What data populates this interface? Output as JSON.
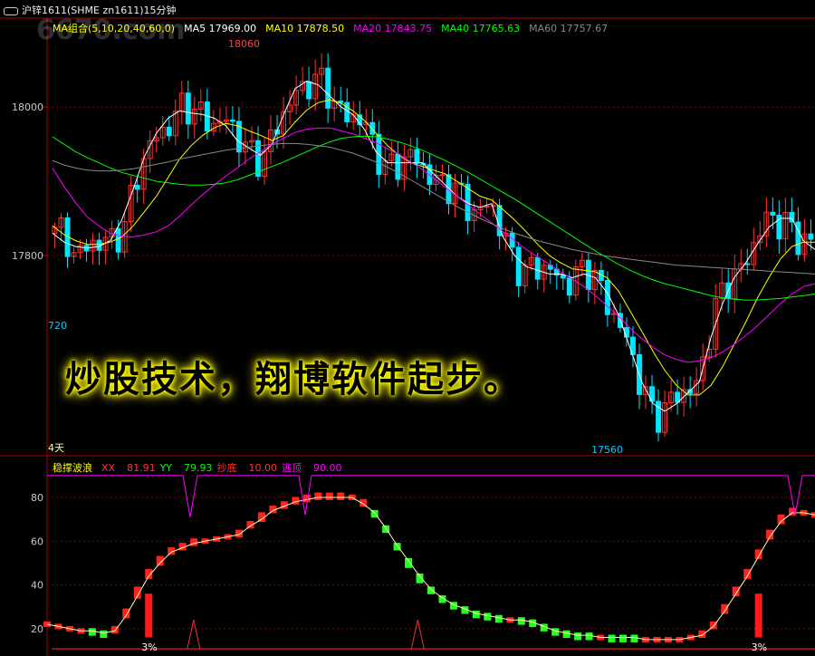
{
  "title_bar": {
    "icon": "link-icon",
    "text": "沪锌1611(SHME zn1611)15分钟"
  },
  "watermark": "6670.com",
  "ma_legend": [
    {
      "label": "MA组合(5,10,20,40,60,0)",
      "color": "#ffff00"
    },
    {
      "label": "MA5 17969.00",
      "color": "#ffffff"
    },
    {
      "label": "MA10 17878.50",
      "color": "#ffff00"
    },
    {
      "label": "MA20 17843.75",
      "color": "#ff00ff"
    },
    {
      "label": "MA40 17765.63",
      "color": "#00ff00"
    },
    {
      "label": "MA60 17757.67",
      "color": "#888888"
    }
  ],
  "overlay_text": "炒股技术，翔博软件起步。",
  "price_labels": {
    "high": "18060",
    "low": "17560",
    "left_mid": "720",
    "period": "4天"
  },
  "indicator_legend": [
    {
      "label": "稳撑波浪",
      "color": "#ffff00"
    },
    {
      "label": "XX",
      "color": "#ff3333"
    },
    {
      "label": "81.91",
      "color": "#ff3333"
    },
    {
      "label": "YY",
      "color": "#00ff00"
    },
    {
      "label": "79.93",
      "color": "#00ff00"
    },
    {
      "label": "抄底",
      "color": "#ff3333"
    },
    {
      "label": "10.00",
      "color": "#ff3333"
    },
    {
      "label": "逃顶",
      "color": "#ff00ff"
    },
    {
      "label": "90.00",
      "color": "#ff00ff"
    }
  ],
  "signal_labels": [
    "3%",
    "3%"
  ],
  "colors": {
    "up": "#ff3232",
    "down": "#00e5ff",
    "grid": "#8b0000",
    "axis": "#b00000",
    "osc_up": "#ff2020",
    "osc_down": "#22ff22"
  },
  "chart_data": [
    {
      "type": "candlestick",
      "ylabel_ticks": [
        "18000",
        "17800"
      ],
      "ylim": [
        17530,
        18120
      ],
      "annotations": [
        "18060",
        "17560"
      ],
      "series": [
        {
          "name": "MA5",
          "color": "#ffffff",
          "values": [
            17830,
            17818,
            17812,
            17810,
            17812,
            17820,
            17848,
            17890,
            17935,
            17965,
            17985,
            17995,
            17992,
            17990,
            17985,
            17975,
            17955,
            17945,
            17935,
            17950,
            17990,
            18025,
            18035,
            18030,
            18015,
            18000,
            17990,
            17970,
            17940,
            17925,
            17925,
            17925,
            17925,
            17910,
            17895,
            17880,
            17870,
            17865,
            17870,
            17825,
            17800,
            17785,
            17780,
            17775,
            17775,
            17770,
            17775,
            17770,
            17750,
            17720,
            17675,
            17630,
            17600,
            17590,
            17600,
            17615,
            17630,
            17690,
            17735,
            17770,
            17790,
            17815,
            17838,
            17850,
            17850,
            17820,
            17808
          ]
        },
        {
          "name": "MA10",
          "color": "#ffff00",
          "values": [
            17840,
            17828,
            17820,
            17815,
            17815,
            17818,
            17825,
            17840,
            17860,
            17880,
            17905,
            17930,
            17948,
            17962,
            17972,
            17978,
            17975,
            17968,
            17962,
            17955,
            17962,
            17980,
            17996,
            18006,
            18010,
            18005,
            17995,
            17982,
            17965,
            17948,
            17935,
            17925,
            17920,
            17915,
            17910,
            17900,
            17890,
            17880,
            17875,
            17862,
            17848,
            17832,
            17815,
            17800,
            17790,
            17782,
            17780,
            17778,
            17770,
            17752,
            17725,
            17698,
            17670,
            17645,
            17625,
            17612,
            17612,
            17625,
            17650,
            17680,
            17710,
            17742,
            17770,
            17795,
            17812,
            17818,
            17818
          ]
        },
        {
          "name": "MA20",
          "color": "#ff00ff",
          "values": [
            17918,
            17893,
            17871,
            17852,
            17840,
            17830,
            17826,
            17825,
            17828,
            17832,
            17840,
            17853,
            17868,
            17882,
            17895,
            17907,
            17918,
            17930,
            17940,
            17950,
            17958,
            17966,
            17970,
            17972,
            17972,
            17968,
            17964,
            17958,
            17952,
            17944,
            17936,
            17926,
            17916,
            17904,
            17892,
            17880,
            17868,
            17856,
            17844,
            17832,
            17820,
            17808,
            17798,
            17788,
            17778,
            17768,
            17758,
            17746,
            17732,
            17718,
            17702,
            17688,
            17676,
            17666,
            17660,
            17656,
            17658,
            17662,
            17670,
            17680,
            17692,
            17705,
            17720,
            17735,
            17748,
            17758,
            17762
          ]
        },
        {
          "name": "MA40",
          "color": "#00ff00",
          "values": [
            17960,
            17950,
            17940,
            17932,
            17925,
            17918,
            17912,
            17908,
            17904,
            17900,
            17898,
            17896,
            17895,
            17895,
            17896,
            17898,
            17902,
            17908,
            17914,
            17920,
            17926,
            17933,
            17940,
            17947,
            17953,
            17958,
            17960,
            17961,
            17960,
            17957,
            17953,
            17948,
            17942,
            17935,
            17928,
            17920,
            17912,
            17903,
            17894,
            17885,
            17876,
            17866,
            17856,
            17846,
            17836,
            17826,
            17816,
            17806,
            17797,
            17788,
            17780,
            17773,
            17767,
            17762,
            17758,
            17754,
            17750,
            17746,
            17743,
            17741,
            17740,
            17740,
            17741,
            17742,
            17744,
            17746,
            17748
          ]
        },
        {
          "name": "MA60",
          "color": "#888888",
          "values": [
            17928,
            17922,
            17918,
            17915,
            17914,
            17914,
            17915,
            17917,
            17920,
            17923,
            17926,
            17930,
            17933,
            17936,
            17939,
            17942,
            17944,
            17946,
            17948,
            17950,
            17951,
            17951,
            17950,
            17948,
            17946,
            17942,
            17938,
            17932,
            17926,
            17919,
            17911,
            17902,
            17893,
            17884,
            17875,
            17866,
            17858,
            17850,
            17843,
            17836,
            17830,
            17825,
            17820,
            17816,
            17812,
            17808,
            17805,
            17802,
            17799,
            17797,
            17795,
            17793,
            17791,
            17789,
            17787,
            17786,
            17785,
            17784,
            17783,
            17782,
            17781,
            17780,
            17779,
            17778,
            17777,
            17776,
            17775
          ]
        }
      ]
    },
    {
      "type": "oscillator",
      "name": "稳撑波浪",
      "yticks": [
        80,
        60,
        40,
        20
      ],
      "ylim": [
        10,
        92
      ],
      "series": [
        {
          "name": "XX",
          "color": "#ff2020",
          "values": [
            22,
            21,
            20,
            19,
            18,
            17,
            20,
            28,
            38,
            46,
            52,
            56,
            58,
            60,
            60,
            61,
            62,
            64,
            68,
            72,
            75,
            77,
            79,
            80,
            81,
            81,
            81,
            80,
            78,
            72,
            65,
            57,
            49,
            42,
            37,
            33,
            30,
            28,
            26,
            25,
            24,
            24,
            23,
            22,
            20,
            18,
            17,
            16,
            16,
            16,
            15,
            15,
            15,
            15,
            15,
            15,
            15,
            16,
            18,
            22,
            30,
            38,
            46,
            55,
            64,
            71,
            74,
            73,
            72
          ]
        },
        {
          "name": "YY",
          "color": "#00ff00",
          "values": [
            22,
            21,
            20,
            19,
            19,
            18,
            19,
            26,
            35,
            44,
            50,
            55,
            57,
            59,
            60,
            61,
            62,
            63,
            67,
            70,
            74,
            76,
            78,
            79,
            80,
            80,
            80,
            80,
            77,
            73,
            66,
            58,
            51,
            44,
            38,
            34,
            31,
            29,
            27,
            26,
            25,
            24,
            24,
            23,
            21,
            19,
            18,
            17,
            17,
            16,
            16,
            16,
            16,
            15,
            15,
            15,
            15,
            16,
            17,
            21,
            28,
            36,
            44,
            53,
            62,
            69,
            73,
            73,
            72
          ]
        }
      ],
      "bottom_signals": [
        17,
        43,
        128,
        157,
        171,
        188
      ],
      "tall_signal_bars": [
        9,
        63
      ]
    }
  ]
}
